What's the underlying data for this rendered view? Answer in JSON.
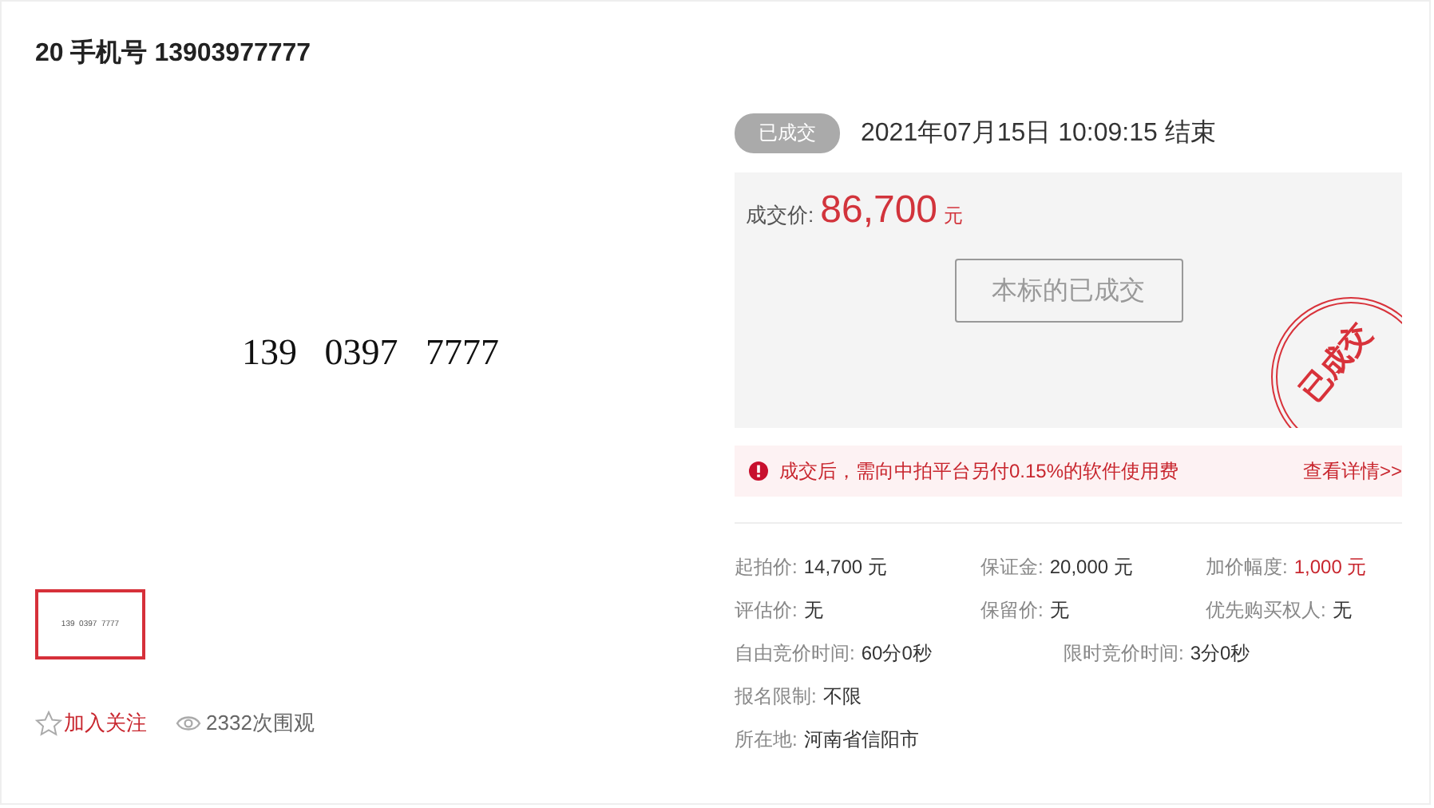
{
  "title": "20 手机号 13903977777",
  "main_image": {
    "number": "139   0397   7777"
  },
  "thumbnail": {
    "number": "139  0397  7777",
    "selected": true
  },
  "follow": {
    "label": "加入关注"
  },
  "views": "2332次围观",
  "status_badge": "已成交",
  "end_time": "2021年07月15日  10:09:15 结束",
  "price": {
    "label": "成交价:",
    "value": "86,700",
    "unit": "元"
  },
  "action_button": {
    "label": "本标的已成交",
    "disabled": true
  },
  "stamp": "已成交",
  "notice": {
    "text": "成交后，需向中拍平台另付0.15%的软件使用费",
    "link": "查看详情>>"
  },
  "info_rows": [
    [
      {
        "label": "起拍价:",
        "value": "14,700 元",
        "highlight": false
      },
      {
        "label": "保证金:",
        "value": "20,000 元",
        "highlight": false
      },
      {
        "label": "加价幅度:",
        "value": "1,000 元",
        "highlight": true
      }
    ],
    [
      {
        "label": "评估价:",
        "value": "无",
        "highlight": false
      },
      {
        "label": "保留价:",
        "value": "无",
        "highlight": false
      },
      {
        "label": "优先购买权人:",
        "value": "无",
        "highlight": false
      }
    ],
    [
      {
        "label": "自由竞价时间:",
        "value": "60分0秒",
        "highlight": false
      },
      {
        "label": "限时竞价时间:",
        "value": "3分0秒",
        "highlight": false
      }
    ],
    [
      {
        "label": "报名限制:",
        "value": "不限",
        "highlight": false
      }
    ],
    [
      {
        "label": "所在地:",
        "value": "河南省信阳市",
        "highlight": false
      }
    ]
  ]
}
